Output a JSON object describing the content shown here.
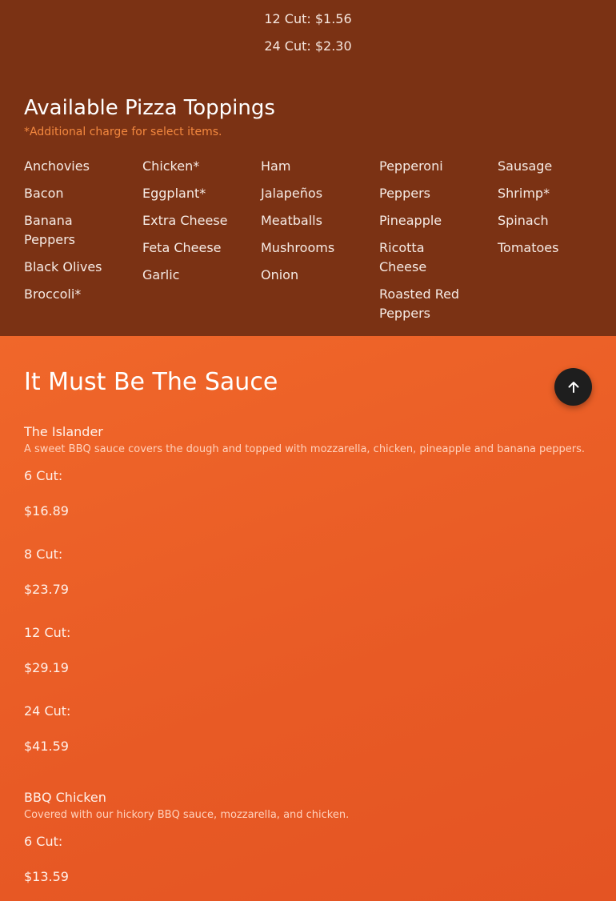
{
  "prev_prices": [
    "12 Cut: $1.56",
    "24 Cut: $2.30"
  ],
  "toppings": {
    "title": "Available Pizza Toppings",
    "note": "*Additional charge for select items.",
    "columns": [
      [
        "Anchovies",
        "Bacon",
        "Banana Peppers",
        "Black Olives",
        "Broccoli*"
      ],
      [
        "Chicken*",
        "Eggplant*",
        "Extra Cheese",
        "Feta Cheese",
        "Garlic"
      ],
      [
        "Ham",
        "Jalapeños",
        "Meatballs",
        "Mushrooms",
        "Onion"
      ],
      [
        "Pepperoni",
        "Peppers",
        "Pineapple",
        "Ricotta Cheese",
        "Roasted Red Peppers"
      ],
      [
        "Sausage",
        "Shrimp*",
        "Spinach",
        "Tomatoes"
      ]
    ]
  },
  "sauce": {
    "title": "It Must Be The Sauce",
    "pizzas": [
      {
        "name": "The Islander",
        "description": "A sweet BBQ sauce covers the dough and topped with mozzarella, chicken, pineapple and banana peppers.",
        "cuts": [
          {
            "label": "6 Cut:",
            "price": "$16.89"
          },
          {
            "label": "8 Cut:",
            "price": "$23.79"
          },
          {
            "label": "12 Cut:",
            "price": "$29.19"
          },
          {
            "label": "24 Cut:",
            "price": "$41.59"
          }
        ]
      },
      {
        "name": "BBQ Chicken",
        "description": "Covered with our hickory BBQ sauce, mozzarella, and chicken.",
        "cuts": [
          {
            "label": "6 Cut:",
            "price": "$13.59"
          }
        ]
      }
    ]
  },
  "back_to_top": {
    "icon": "arrow-up-icon"
  }
}
